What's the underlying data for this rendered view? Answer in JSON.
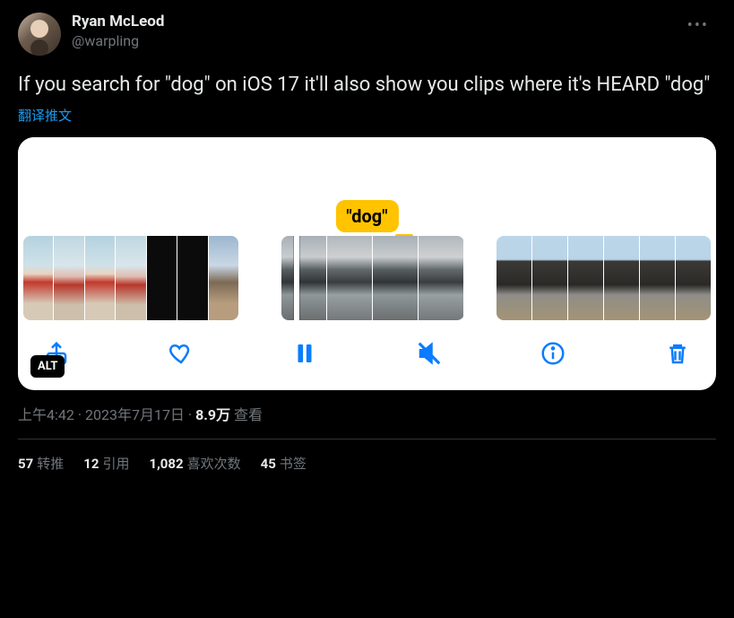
{
  "author": {
    "display_name": "Ryan McLeod",
    "handle": "@warpling"
  },
  "tweet_text": "If you search for \"dog\" on iOS 17 it'll also show you clips where it's HEARD \"dog\"",
  "translate_label": "翻译推文",
  "media": {
    "caption_bubble": "\"dog\"",
    "alt_badge": "ALT",
    "toolbar_icons": [
      "share",
      "like",
      "pause",
      "mute",
      "info",
      "trash"
    ]
  },
  "meta": {
    "time": "上午4:42",
    "separator": " · ",
    "date": "2023年7月17日",
    "views_count": "8.9万",
    "views_label": "查看"
  },
  "stats": {
    "retweets": {
      "count": "57",
      "label": "转推"
    },
    "quotes": {
      "count": "12",
      "label": "引用"
    },
    "likes": {
      "count": "1,082",
      "label": "喜欢次数"
    },
    "bookmarks": {
      "count": "45",
      "label": "书签"
    }
  }
}
